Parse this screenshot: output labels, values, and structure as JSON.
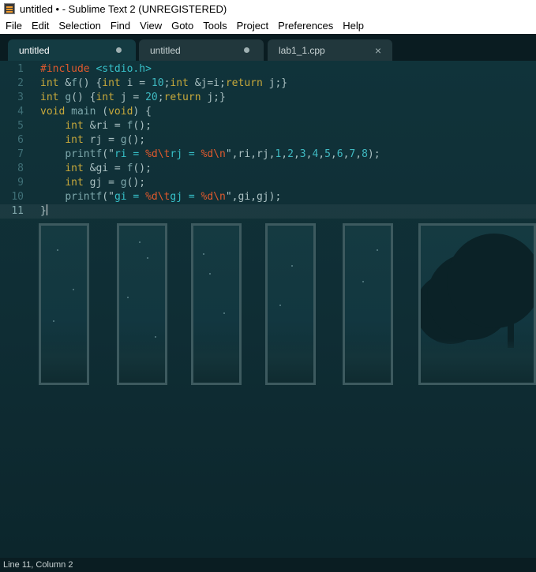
{
  "window": {
    "title": "untitled • - Sublime Text 2 (UNREGISTERED)",
    "app_icon": "sublime-text-icon"
  },
  "menu": [
    "File",
    "Edit",
    "Selection",
    "Find",
    "View",
    "Goto",
    "Tools",
    "Project",
    "Preferences",
    "Help"
  ],
  "tabs": [
    {
      "label": "untitled",
      "state": "modified",
      "active": true
    },
    {
      "label": "untitled",
      "state": "modified",
      "active": false
    },
    {
      "label": "lab1_1.cpp",
      "state": "close",
      "active": false
    }
  ],
  "editor": {
    "line_numbers": [
      "1",
      "2",
      "3",
      "4",
      "5",
      "6",
      "7",
      "8",
      "9",
      "10",
      "11"
    ],
    "current_line": 11,
    "lines": [
      [
        {
          "t": "#include ",
          "c": "pp"
        },
        {
          "t": "<stdio.h>",
          "c": "s"
        }
      ],
      [
        {
          "t": "int",
          "c": "k"
        },
        {
          "t": " &",
          "c": ""
        },
        {
          "t": "f",
          "c": "f"
        },
        {
          "t": "() {",
          "c": ""
        },
        {
          "t": "int",
          "c": "k"
        },
        {
          "t": " i = ",
          "c": ""
        },
        {
          "t": "10",
          "c": "n"
        },
        {
          "t": ";",
          "c": ""
        },
        {
          "t": "int",
          "c": "k"
        },
        {
          "t": " &j=i;",
          "c": ""
        },
        {
          "t": "return",
          "c": "k"
        },
        {
          "t": " j;}",
          "c": ""
        }
      ],
      [
        {
          "t": "int",
          "c": "k"
        },
        {
          "t": " ",
          "c": ""
        },
        {
          "t": "g",
          "c": "f"
        },
        {
          "t": "() {",
          "c": ""
        },
        {
          "t": "int",
          "c": "k"
        },
        {
          "t": " j = ",
          "c": ""
        },
        {
          "t": "20",
          "c": "n"
        },
        {
          "t": ";",
          "c": ""
        },
        {
          "t": "return",
          "c": "k"
        },
        {
          "t": " j;}",
          "c": ""
        }
      ],
      [
        {
          "t": "void",
          "c": "k"
        },
        {
          "t": " ",
          "c": ""
        },
        {
          "t": "main",
          "c": "f"
        },
        {
          "t": " (",
          "c": ""
        },
        {
          "t": "void",
          "c": "k"
        },
        {
          "t": ") {",
          "c": ""
        }
      ],
      [
        {
          "t": "    ",
          "c": ""
        },
        {
          "t": "int",
          "c": "k"
        },
        {
          "t": " &ri = ",
          "c": ""
        },
        {
          "t": "f",
          "c": "f"
        },
        {
          "t": "();",
          "c": ""
        }
      ],
      [
        {
          "t": "    ",
          "c": ""
        },
        {
          "t": "int",
          "c": "k"
        },
        {
          "t": " rj = ",
          "c": ""
        },
        {
          "t": "g",
          "c": "f"
        },
        {
          "t": "();",
          "c": ""
        }
      ],
      [
        {
          "t": "    ",
          "c": ""
        },
        {
          "t": "printf",
          "c": "f"
        },
        {
          "t": "(\"",
          "c": ""
        },
        {
          "t": "ri = ",
          "c": "s"
        },
        {
          "t": "%d\\t",
          "c": "pp"
        },
        {
          "t": "rj = ",
          "c": "s"
        },
        {
          "t": "%d\\n",
          "c": "pp"
        },
        {
          "t": "\",ri,rj,",
          "c": ""
        },
        {
          "t": "1",
          "c": "n"
        },
        {
          "t": ",",
          "c": ""
        },
        {
          "t": "2",
          "c": "n"
        },
        {
          "t": ",",
          "c": ""
        },
        {
          "t": "3",
          "c": "n"
        },
        {
          "t": ",",
          "c": ""
        },
        {
          "t": "4",
          "c": "n"
        },
        {
          "t": ",",
          "c": ""
        },
        {
          "t": "5",
          "c": "n"
        },
        {
          "t": ",",
          "c": ""
        },
        {
          "t": "6",
          "c": "n"
        },
        {
          "t": ",",
          "c": ""
        },
        {
          "t": "7",
          "c": "n"
        },
        {
          "t": ",",
          "c": ""
        },
        {
          "t": "8",
          "c": "n"
        },
        {
          "t": ");",
          "c": ""
        }
      ],
      [
        {
          "t": "    ",
          "c": ""
        },
        {
          "t": "int",
          "c": "k"
        },
        {
          "t": " &gi = ",
          "c": ""
        },
        {
          "t": "f",
          "c": "f"
        },
        {
          "t": "();",
          "c": ""
        }
      ],
      [
        {
          "t": "    ",
          "c": ""
        },
        {
          "t": "int",
          "c": "k"
        },
        {
          "t": " gj = ",
          "c": ""
        },
        {
          "t": "g",
          "c": "f"
        },
        {
          "t": "();",
          "c": ""
        }
      ],
      [
        {
          "t": "    ",
          "c": ""
        },
        {
          "t": "printf",
          "c": "f"
        },
        {
          "t": "(\"",
          "c": ""
        },
        {
          "t": "gi = ",
          "c": "s"
        },
        {
          "t": "%d\\t",
          "c": "pp"
        },
        {
          "t": "gj = ",
          "c": "s"
        },
        {
          "t": "%d\\n",
          "c": "pp"
        },
        {
          "t": "\",gi,gj);",
          "c": ""
        }
      ],
      [
        {
          "t": "}",
          "c": ""
        }
      ]
    ]
  },
  "colors": {
    "keyword": "#c7a83b",
    "preprocessor": "#e0592d",
    "string": "#37c0c8",
    "number": "#3fb9c1",
    "function": "#7ea8ac",
    "default": "#aac0c2"
  },
  "status": {
    "position": "Line 11, Column 2"
  }
}
